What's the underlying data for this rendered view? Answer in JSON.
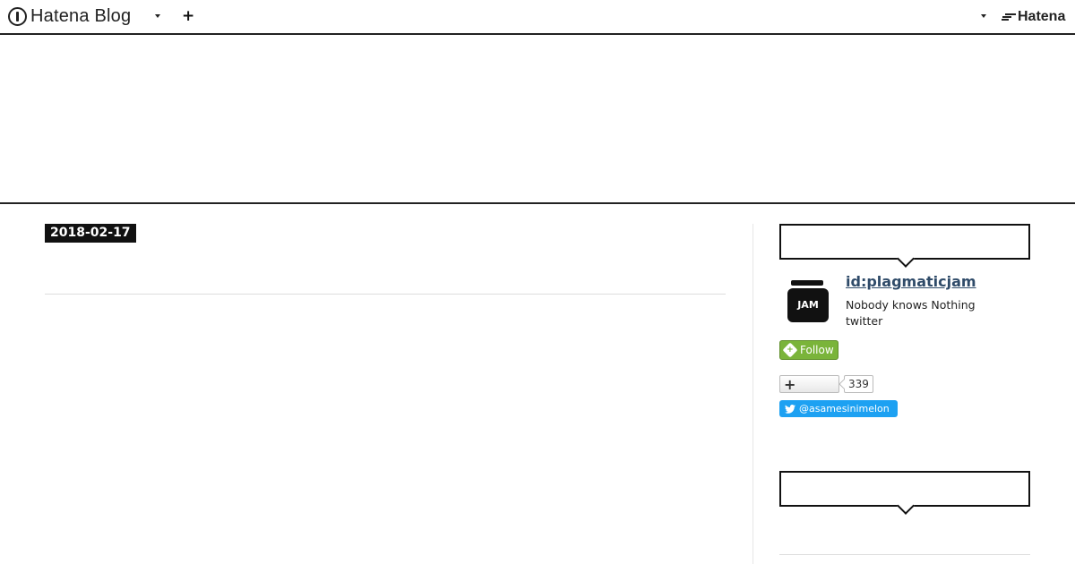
{
  "global_header": {
    "brand": "Hatena Blog",
    "add_icon": "plus-icon",
    "hatena_label": "Hatena"
  },
  "entry": {
    "date": "2018-02-17"
  },
  "sidebar": {
    "profile": {
      "id": "id:plagmaticjam",
      "avatar_text": "JAM",
      "description_line1": "Nobody knows Nothing",
      "description_line2": "twitter",
      "follow_label": "Follow",
      "bookmark_count": "339",
      "twitter_handle": "@asamesinimelon"
    }
  },
  "colors": {
    "follow_green": "#7ab43a",
    "twitter_blue": "#1da1f2",
    "profile_link": "#2f4b69"
  }
}
